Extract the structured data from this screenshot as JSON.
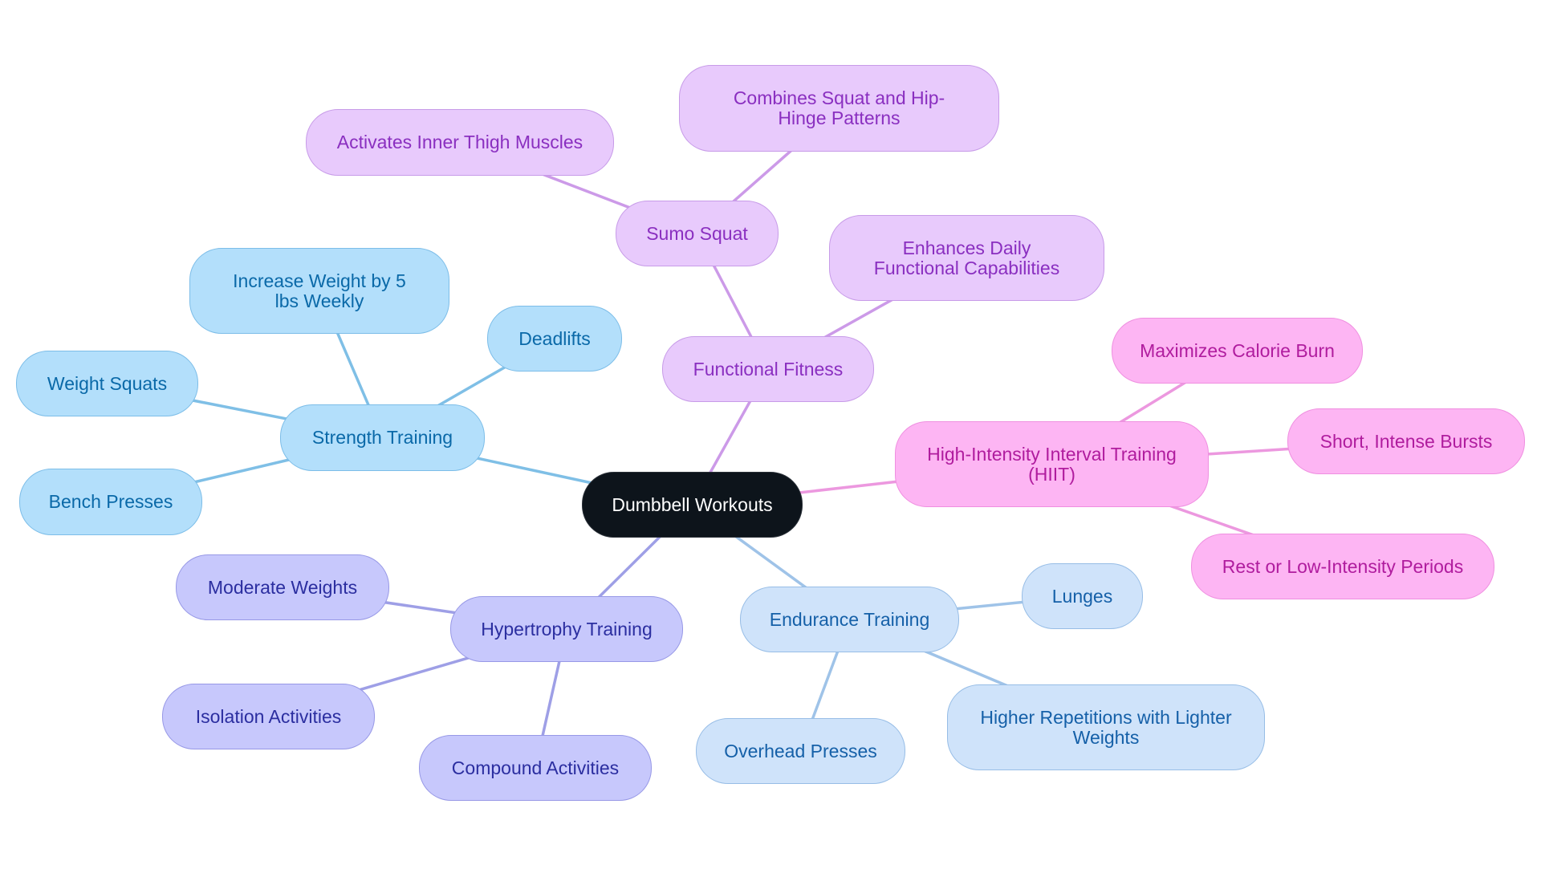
{
  "title": "Dumbbell Workouts",
  "colors": {
    "strength_edge": "#7fbfe6",
    "functional_edge": "#cc9ae8",
    "hiit_edge": "#ec98df",
    "endurance_edge": "#9fc3e8",
    "hypertrophy_edge": "#9e9fe6"
  },
  "nodes": {
    "root": "Dumbbell Workouts",
    "strength": "Strength Training",
    "strength_increase": "Increase Weight by 5 lbs Weekly",
    "strength_deadlifts": "Deadlifts",
    "strength_squats": "Weight Squats",
    "strength_bench": "Bench Presses",
    "functional": "Functional Fitness",
    "functional_sumo": "Sumo Squat",
    "functional_sumo_inner": "Activates Inner Thigh Muscles",
    "functional_sumo_combines": "Combines Squat and Hip-Hinge Patterns",
    "functional_enhances": "Enhances Daily Functional Capabilities",
    "hiit": "High-Intensity Interval Training (HIIT)",
    "hiit_calorie": "Maximizes Calorie Burn",
    "hiit_bursts": "Short, Intense Bursts",
    "hiit_rest": "Rest or Low-Intensity Periods",
    "endurance": "Endurance Training",
    "endurance_lunges": "Lunges",
    "endurance_reps": "Higher Repetitions with Lighter Weights",
    "endurance_overhead": "Overhead Presses",
    "hypertrophy": "Hypertrophy Training",
    "hypertrophy_moderate": "Moderate Weights",
    "hypertrophy_isolation": "Isolation Activities",
    "hypertrophy_compound": "Compound Activities"
  },
  "edges": [
    [
      "root",
      "strength",
      "strength_edge"
    ],
    [
      "strength",
      "strength_increase",
      "strength_edge"
    ],
    [
      "strength",
      "strength_deadlifts",
      "strength_edge"
    ],
    [
      "strength",
      "strength_squats",
      "strength_edge"
    ],
    [
      "strength",
      "strength_bench",
      "strength_edge"
    ],
    [
      "root",
      "functional",
      "functional_edge"
    ],
    [
      "functional",
      "functional_sumo",
      "functional_edge"
    ],
    [
      "functional_sumo",
      "functional_sumo_inner",
      "functional_edge"
    ],
    [
      "functional_sumo",
      "functional_sumo_combines",
      "functional_edge"
    ],
    [
      "functional",
      "functional_enhances",
      "functional_edge"
    ],
    [
      "root",
      "hiit",
      "hiit_edge"
    ],
    [
      "hiit",
      "hiit_calorie",
      "hiit_edge"
    ],
    [
      "hiit",
      "hiit_bursts",
      "hiit_edge"
    ],
    [
      "hiit",
      "hiit_rest",
      "hiit_edge"
    ],
    [
      "root",
      "endurance",
      "endurance_edge"
    ],
    [
      "endurance",
      "endurance_lunges",
      "endurance_edge"
    ],
    [
      "endurance",
      "endurance_reps",
      "endurance_edge"
    ],
    [
      "endurance",
      "endurance_overhead",
      "endurance_edge"
    ],
    [
      "root",
      "hypertrophy",
      "hypertrophy_edge"
    ],
    [
      "hypertrophy",
      "hypertrophy_moderate",
      "hypertrophy_edge"
    ],
    [
      "hypertrophy",
      "hypertrophy_isolation",
      "hypertrophy_edge"
    ],
    [
      "hypertrophy",
      "hypertrophy_compound",
      "hypertrophy_edge"
    ]
  ]
}
